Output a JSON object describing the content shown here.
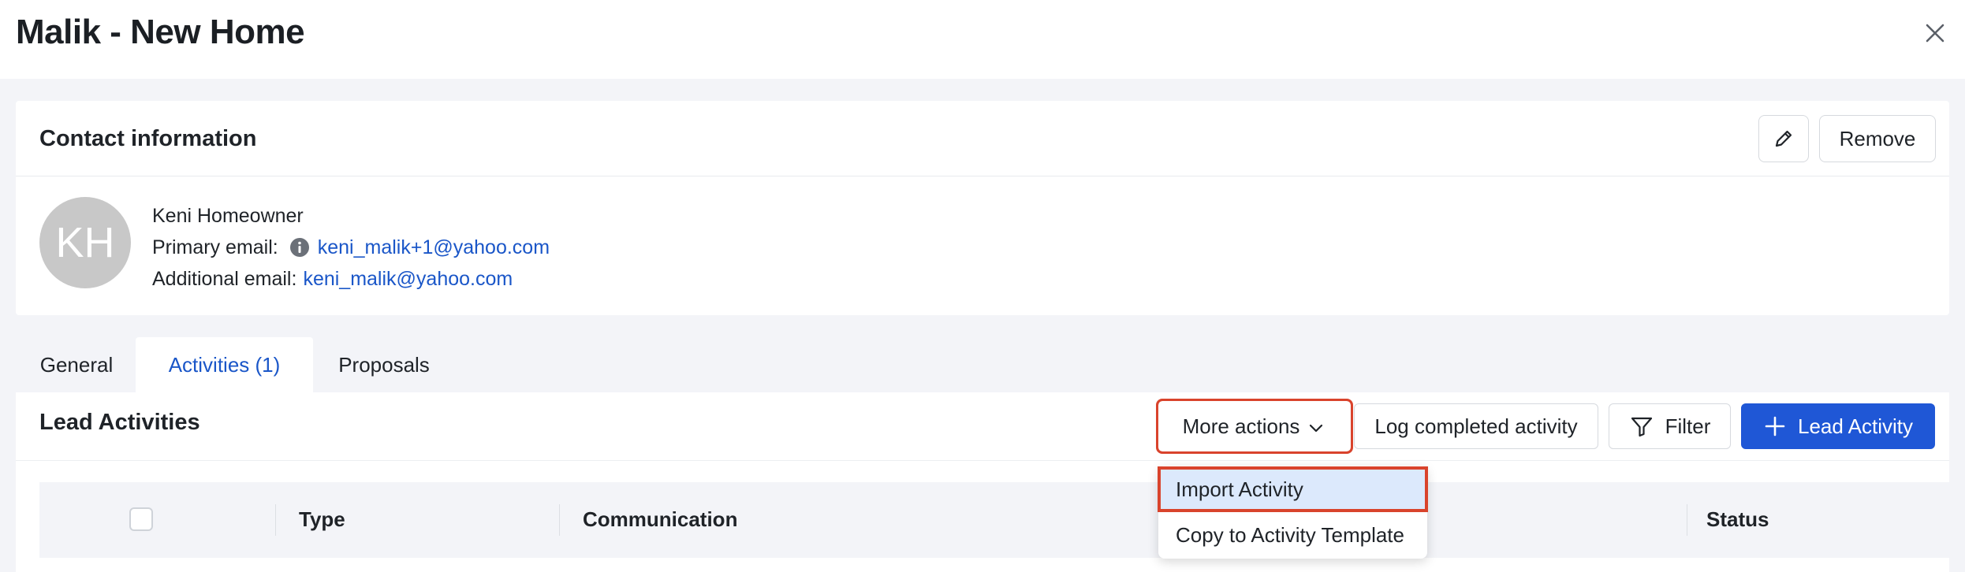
{
  "header": {
    "title": "Malik - New Home"
  },
  "contact_card": {
    "title": "Contact information",
    "remove_label": "Remove",
    "avatar_initials": "KH",
    "name": "Keni Homeowner",
    "primary_email_label": "Primary email:",
    "primary_email": "keni_malik+1@yahoo.com",
    "additional_email_label": "Additional email:",
    "additional_email": "keni_malik@yahoo.com"
  },
  "tabs": [
    {
      "label": "General",
      "active": false
    },
    {
      "label": "Activities (1)",
      "active": true
    },
    {
      "label": "Proposals",
      "active": false
    }
  ],
  "activities_panel": {
    "title": "Lead Activities",
    "more_actions_label": "More actions",
    "log_completed_label": "Log completed activity",
    "filter_label": "Filter",
    "add_activity_label": "Lead Activity",
    "columns": [
      "Type",
      "Communication",
      "Status"
    ]
  },
  "more_actions_menu": {
    "items": [
      "Import Activity",
      "Copy to Activity Template"
    ]
  },
  "colors": {
    "accent": "#1f57d6",
    "link": "#1a56c8",
    "highlight_outline": "#d9432c",
    "menu_highlight": "#dce9fc"
  }
}
